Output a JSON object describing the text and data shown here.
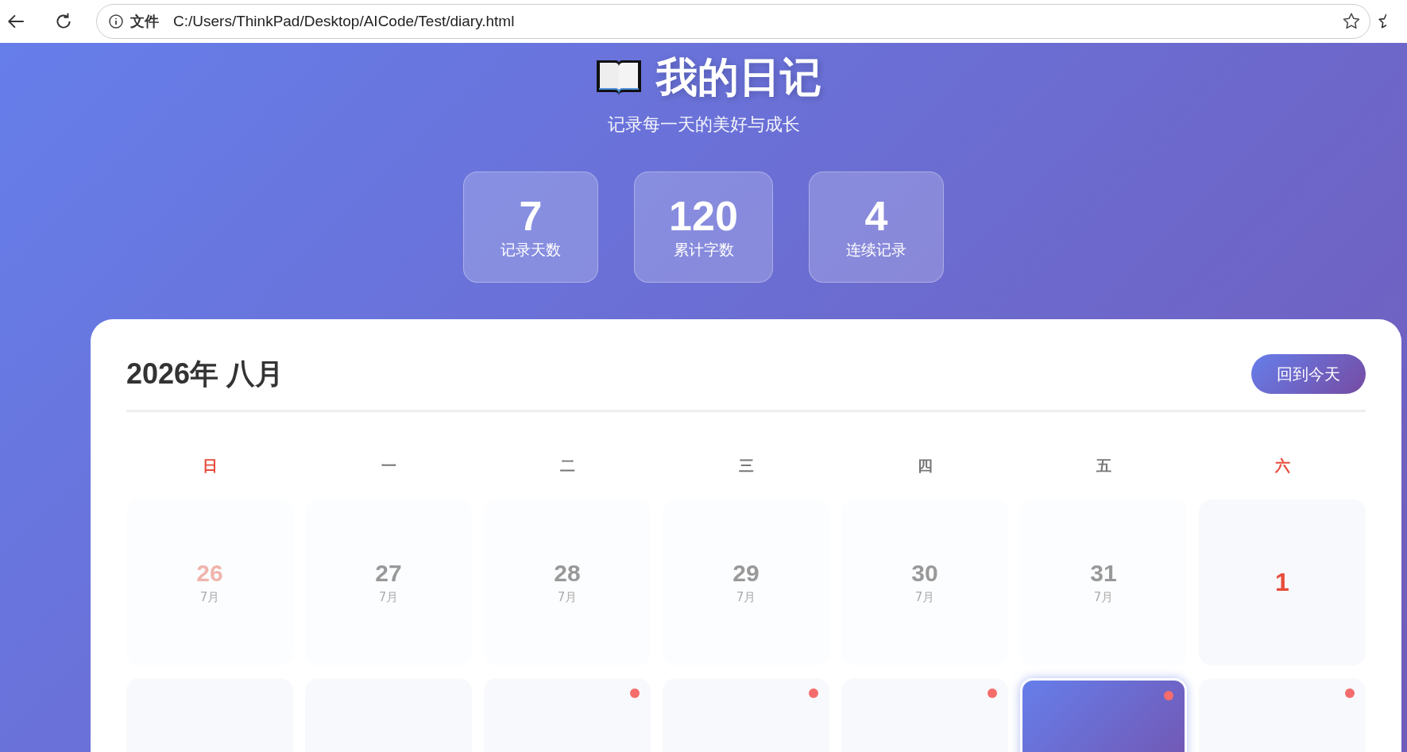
{
  "browser": {
    "scheme_label": "文件",
    "url": "C:/Users/ThinkPad/Desktop/AICode/Test/diary.html"
  },
  "header": {
    "title": "我的日记",
    "subtitle": "记录每一天的美好与成长"
  },
  "stats": [
    {
      "value": "7",
      "label": "记录天数"
    },
    {
      "value": "120",
      "label": "累计字数"
    },
    {
      "value": "4",
      "label": "连续记录"
    }
  ],
  "calendar": {
    "title": "2026年 八月",
    "today_button": "回到今天",
    "weekdays": [
      {
        "label": "日",
        "weekend": true
      },
      {
        "label": "一",
        "weekend": false
      },
      {
        "label": "二",
        "weekend": false
      },
      {
        "label": "三",
        "weekend": false
      },
      {
        "label": "四",
        "weekend": false
      },
      {
        "label": "五",
        "weekend": false
      },
      {
        "label": "六",
        "weekend": true
      }
    ],
    "weeks": [
      [
        {
          "day": "26",
          "month": "7月",
          "other_month": true,
          "weekend": true
        },
        {
          "day": "27",
          "month": "7月",
          "other_month": true,
          "weekend": false
        },
        {
          "day": "28",
          "month": "7月",
          "other_month": true,
          "weekend": false
        },
        {
          "day": "29",
          "month": "7月",
          "other_month": true,
          "weekend": false
        },
        {
          "day": "30",
          "month": "7月",
          "other_month": true,
          "weekend": false
        },
        {
          "day": "31",
          "month": "7月",
          "other_month": true,
          "weekend": false
        },
        {
          "day": "1",
          "other_month": false,
          "weekend": true
        }
      ],
      [
        {
          "has_entry": false,
          "selected": false
        },
        {
          "has_entry": false,
          "selected": false
        },
        {
          "has_entry": true,
          "selected": false
        },
        {
          "has_entry": true,
          "selected": false
        },
        {
          "has_entry": true,
          "selected": false
        },
        {
          "has_entry": true,
          "selected": true
        },
        {
          "has_entry": true,
          "selected": false
        }
      ]
    ]
  }
}
